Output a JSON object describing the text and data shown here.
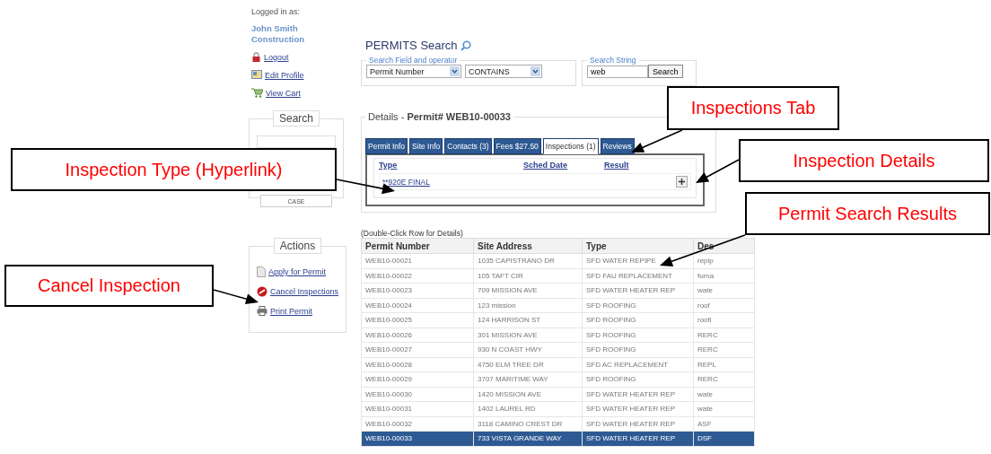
{
  "sidebar": {
    "logged_in_label": "Logged in as:",
    "user": "John Smith Construction",
    "links": [
      {
        "label": "Logout"
      },
      {
        "label": "Edit Profile"
      },
      {
        "label": "View Cart"
      }
    ],
    "search_panel": {
      "title": "Search",
      "button": "CASE"
    },
    "actions_panel": {
      "title": "Actions",
      "links": [
        {
          "label": "Apply for Permit"
        },
        {
          "label": "Cancel Inspections"
        },
        {
          "label": "Print Permit"
        }
      ]
    }
  },
  "main": {
    "title": "PERMITS Search",
    "search": {
      "field_legend": "Search Field and operator",
      "field": "Permit Number",
      "operator": "CONTAINS",
      "string_legend": "Search String",
      "value": "web",
      "button": "Search"
    },
    "details": {
      "title": "Details - **Permit# WEB10-00033**",
      "tabs": [
        {
          "label": "Permit Info",
          "selected": false
        },
        {
          "label": "Site Info",
          "selected": false
        },
        {
          "label": "Contacts (3)",
          "selected": false
        },
        {
          "label": "Fees $27.50",
          "selected": false
        },
        {
          "label": "Inspections (1)",
          "selected": true
        },
        {
          "label": "Reviews",
          "selected": false
        }
      ],
      "inspections": {
        "columns": [
          "Type",
          "Sched Date",
          "Result"
        ],
        "rows": [
          {
            "type": "**920E FINAL"
          }
        ]
      }
    },
    "results": {
      "note": "(Double-Click Row for Details)",
      "columns": [
        "Permit Number",
        "Site Address",
        "Type",
        "Des"
      ],
      "rows": [
        {
          "cells": [
            "WEB10-00021",
            "1035 CAPISTRANO DR",
            "SFD WATER REPIPE",
            "repip"
          ],
          "selected": false
        },
        {
          "cells": [
            "WEB10-00022",
            "105 TAFT CIR",
            "SFD FAU REPLACEMENT",
            "furna"
          ],
          "selected": false
        },
        {
          "cells": [
            "WEB10-00023",
            "709 MISSION AVE",
            "SFD WATER HEATER REP",
            "wate"
          ],
          "selected": false
        },
        {
          "cells": [
            "WEB10-00024",
            "123 mission",
            "SFD ROOFING",
            "roof"
          ],
          "selected": false
        },
        {
          "cells": [
            "WEB10-00025",
            "124 HARRISON ST",
            "SFD ROOFING",
            "roofi"
          ],
          "selected": false
        },
        {
          "cells": [
            "WEB10-00026",
            "301 MISSION AVE",
            "SFD ROOFING",
            "RERC"
          ],
          "selected": false
        },
        {
          "cells": [
            "WEB10-00027",
            "930 N COAST HWY",
            "SFD ROOFING",
            "RERC"
          ],
          "selected": false
        },
        {
          "cells": [
            "WEB10-00028",
            "4750 ELM TREE DR",
            "SFD AC REPLACEMENT",
            "REPL"
          ],
          "selected": false
        },
        {
          "cells": [
            "WEB10-00029",
            "3707 MARITIME WAY",
            "SFD ROOFING",
            "RERC"
          ],
          "selected": false
        },
        {
          "cells": [
            "WEB10-00030",
            "1420 MISSION AVE",
            "SFD WATER HEATER REP",
            "wate"
          ],
          "selected": false
        },
        {
          "cells": [
            "WEB10-00031",
            "1402 LAUREL RD",
            "SFD WATER HEATER REP",
            "wate"
          ],
          "selected": false
        },
        {
          "cells": [
            "WEB10-00032",
            "3118 CAMINO CREST DR",
            "SFD WATER HEATER REP",
            "ASF"
          ],
          "selected": false
        },
        {
          "cells": [
            "WEB10-00033",
            "733 VISTA GRANDE WAY",
            "SFD WATER HEATER REP",
            "DSF"
          ],
          "selected": true
        }
      ]
    }
  },
  "callouts": [
    {
      "text": "Inspections Tab"
    },
    {
      "text": "Inspection Details"
    },
    {
      "text": "Permit Search Results"
    },
    {
      "text": "Inspection Type (Hyperlink)"
    },
    {
      "text": "Cancel Inspection"
    }
  ]
}
